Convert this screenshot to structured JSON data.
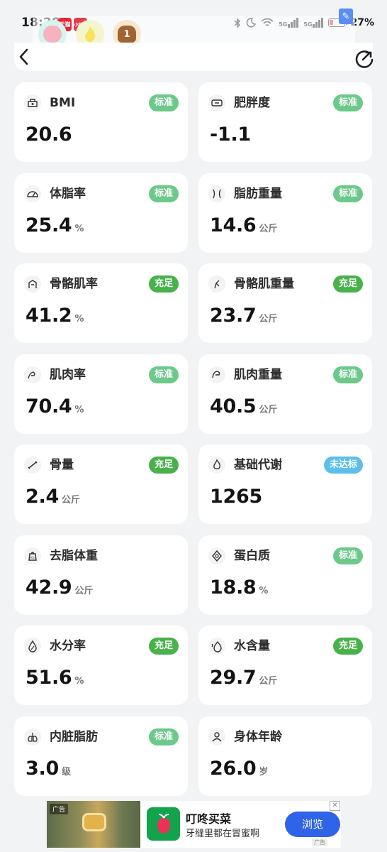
{
  "status_bar": {
    "time": "18:28",
    "battery": "27%",
    "signal_1": "5G",
    "signal_2": "5G",
    "app_badge_1": "天猫",
    "app_badge_2": "小红书"
  },
  "emoji_row": {
    "third_count": "1"
  },
  "metrics": [
    {
      "label": "BMI",
      "value": "20.6",
      "unit": "",
      "status": "标准",
      "status_type": "standard",
      "icon": "scale-icon"
    },
    {
      "label": "肥胖度",
      "value": "-1.1",
      "unit": "",
      "status": "标准",
      "status_type": "standard",
      "icon": "belt-icon"
    },
    {
      "label": "体脂率",
      "value": "25.4",
      "unit": "%",
      "status": "标准",
      "status_type": "standard",
      "icon": "gauge-icon"
    },
    {
      "label": "脂肪重量",
      "value": "14.6",
      "unit": "公斤",
      "status": "标准",
      "status_type": "standard",
      "icon": "waist-icon"
    },
    {
      "label": "骨骼肌率",
      "value": "41.2",
      "unit": "%",
      "status": "充足",
      "status_type": "ample",
      "icon": "torso-icon"
    },
    {
      "label": "骨骼肌重量",
      "value": "23.7",
      "unit": "公斤",
      "status": "充足",
      "status_type": "ample",
      "icon": "muscle-leg-icon"
    },
    {
      "label": "肌肉率",
      "value": "70.4",
      "unit": "%",
      "status": "标准",
      "status_type": "standard",
      "icon": "arm-icon"
    },
    {
      "label": "肌肉重量",
      "value": "40.5",
      "unit": "公斤",
      "status": "标准",
      "status_type": "standard",
      "icon": "flex-arm-icon"
    },
    {
      "label": "骨量",
      "value": "2.4",
      "unit": "公斤",
      "status": "充足",
      "status_type": "ample",
      "icon": "bone-icon"
    },
    {
      "label": "基础代谢",
      "value": "1265",
      "unit": "",
      "status": "未达标",
      "status_type": "below",
      "icon": "flame-icon"
    },
    {
      "label": "去脂体重",
      "value": "42.9",
      "unit": "公斤",
      "status": "",
      "status_type": "none",
      "icon": "kg-weight-icon"
    },
    {
      "label": "蛋白质",
      "value": "18.8",
      "unit": "%",
      "status": "标准",
      "status_type": "standard",
      "icon": "protein-icon"
    },
    {
      "label": "水分率",
      "value": "51.6",
      "unit": "%",
      "status": "充足",
      "status_type": "ample",
      "icon": "water-percent-icon"
    },
    {
      "label": "水含量",
      "value": "29.7",
      "unit": "公斤",
      "status": "充足",
      "status_type": "ample",
      "icon": "water-drop-icon"
    },
    {
      "label": "内脏脂肪",
      "value": "3.0",
      "unit": "级",
      "status": "标准",
      "status_type": "standard",
      "icon": "lungs-icon"
    },
    {
      "label": "身体年龄",
      "value": "26.0",
      "unit": "岁",
      "status": "",
      "status_type": "none",
      "icon": "person-icon"
    }
  ],
  "ad": {
    "tag": "广告",
    "title": "叮咚买菜",
    "subtitle": "牙缝里都在冒蜜啊",
    "button": "浏览",
    "mark": "广告",
    "close": "✕"
  },
  "colors": {
    "standard": "#6cc98a",
    "ample": "#48b24a",
    "below": "#5bbfea",
    "ad_button": "#2f63e8"
  }
}
